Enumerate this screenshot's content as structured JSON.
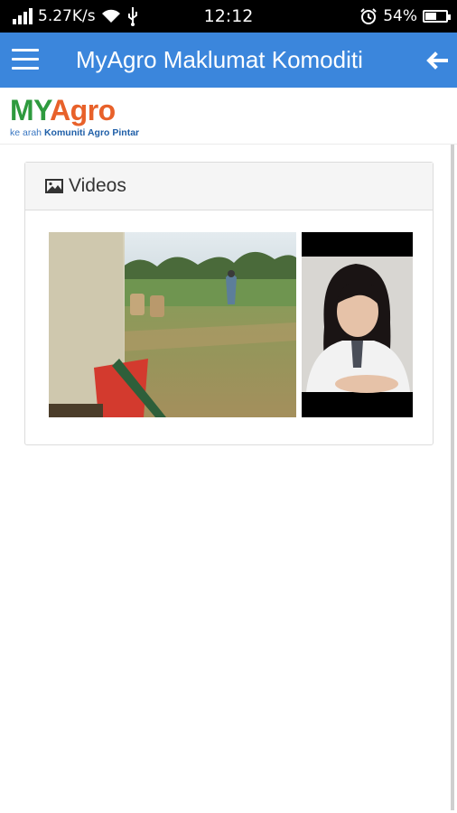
{
  "status_bar": {
    "network_speed": "5.27K/s",
    "time": "12:12",
    "battery_percent": "54%",
    "battery_level": 0.54,
    "icons": [
      "signal-icon",
      "wifi-icon",
      "usb-icon",
      "alarm-icon",
      "battery-icon"
    ]
  },
  "app_bar": {
    "title": "MyAgro Maklumat Komoditi",
    "background_color": "#3b86dc",
    "icons": [
      "menu-icon",
      "back-arrow-icon"
    ]
  },
  "logo": {
    "part1": "MY",
    "part2": "Agro",
    "tagline_prefix": "ke arah ",
    "tagline_bold": "Komuniti Agro Pintar",
    "colors": {
      "my": "#2e9a3e",
      "agro": "#e8612a",
      "tagline": "#3a77c2"
    }
  },
  "videos_panel": {
    "heading": "Videos",
    "heading_icon": "picture-icon",
    "thumbnails": [
      {
        "name": "rice-field-harvest-video-thumbnail"
      },
      {
        "name": "girl-interview-video-thumbnail"
      }
    ]
  }
}
